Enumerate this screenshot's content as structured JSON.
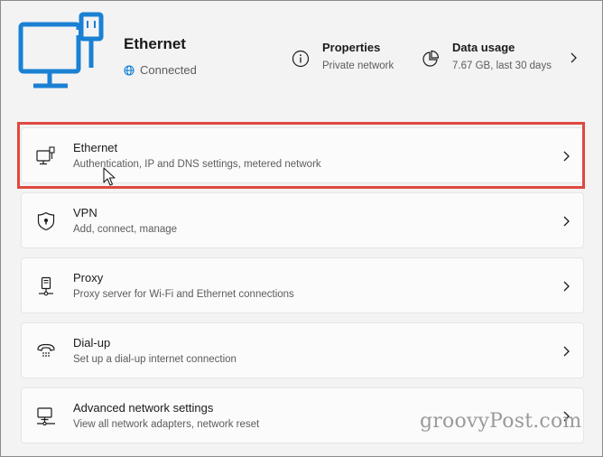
{
  "header": {
    "title": "Ethernet",
    "status": "Connected",
    "properties": {
      "label": "Properties",
      "value": "Private network"
    },
    "data_usage": {
      "label": "Data usage",
      "value": "7.67 GB, last 30 days"
    }
  },
  "items": [
    {
      "label": "Ethernet",
      "desc": "Authentication, IP and DNS settings, metered network",
      "icon": "ethernet-icon"
    },
    {
      "label": "VPN",
      "desc": "Add, connect, manage",
      "icon": "shield-icon"
    },
    {
      "label": "Proxy",
      "desc": "Proxy server for Wi-Fi and Ethernet connections",
      "icon": "proxy-icon"
    },
    {
      "label": "Dial-up",
      "desc": "Set up a dial-up internet connection",
      "icon": "phone-icon"
    },
    {
      "label": "Advanced network settings",
      "desc": "View all network adapters, network reset",
      "icon": "network-adapter-icon"
    }
  ],
  "watermark": "groovyPost.com",
  "colors": {
    "accent": "#0078d4",
    "highlight": "#e0483f"
  }
}
